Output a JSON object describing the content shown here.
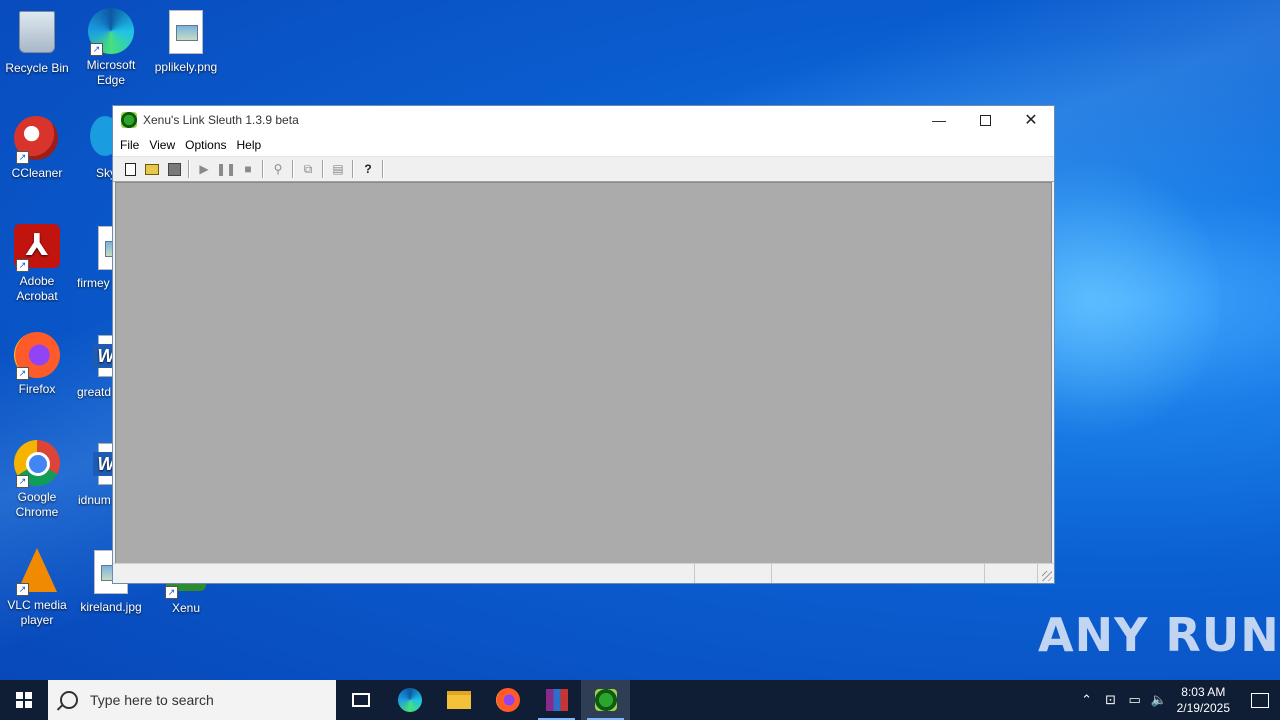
{
  "desktop": {
    "icons": [
      {
        "label": "Recycle Bin"
      },
      {
        "label": "Microsoft Edge"
      },
      {
        "label": "pplikely.png"
      },
      {
        "label": "CCleaner"
      },
      {
        "label": "Sky"
      },
      {
        "label": "Adobe Acrobat"
      },
      {
        "label": "firmey"
      },
      {
        "label": "Firefox"
      },
      {
        "label": "greatd"
      },
      {
        "label": "Google Chrome"
      },
      {
        "label": "idnum"
      },
      {
        "label": "VLC media player"
      },
      {
        "label": "kireland.jpg"
      },
      {
        "label": "Xenu"
      }
    ]
  },
  "window": {
    "title": "Xenu's Link Sleuth 1.3.9 beta",
    "menu": [
      "File",
      "View",
      "Options",
      "Help"
    ],
    "toolbar": [
      "new-icon",
      "open-icon",
      "save-icon",
      "play-icon",
      "pause-icon",
      "stop-icon",
      "find-icon",
      "copy-icon",
      "properties-icon",
      "help-icon"
    ]
  },
  "taskbar": {
    "search_placeholder": "Type here to search",
    "time": "8:03 AM",
    "date": "2/19/2025"
  },
  "watermark": "ANY RUN"
}
